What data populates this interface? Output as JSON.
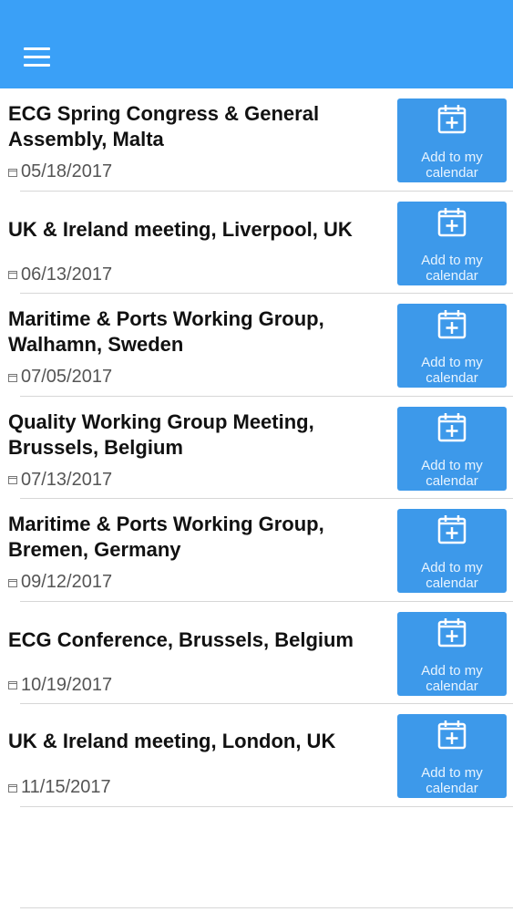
{
  "events": [
    {
      "title": "ECG Spring Congress & General Assembly, Malta",
      "date": "05/18/2017",
      "button_label": "Add to my calendar"
    },
    {
      "title": "UK & Ireland meeting, Liverpool, UK",
      "date": "06/13/2017",
      "button_label": "Add to my calendar"
    },
    {
      "title": "Maritime & Ports Working Group, Walhamn, Sweden",
      "date": "07/05/2017",
      "button_label": "Add to my calendar"
    },
    {
      "title": "Quality Working Group Meeting, Brussels, Belgium",
      "date": "07/13/2017",
      "button_label": "Add to my calendar"
    },
    {
      "title": "Maritime & Ports Working Group, Bremen, Germany",
      "date": "09/12/2017",
      "button_label": "Add to my calendar"
    },
    {
      "title": "ECG Conference, Brussels, Belgium",
      "date": "10/19/2017",
      "button_label": "Add to my calendar"
    },
    {
      "title": "UK & Ireland meeting, London, UK",
      "date": "11/15/2017",
      "button_label": "Add to my calendar"
    }
  ],
  "icons": {
    "menu": "hamburger-menu-icon",
    "date": "calendar-small-icon",
    "add": "calendar-plus-icon"
  },
  "colors": {
    "header": "#3aa0f7",
    "button": "#3d99ea",
    "title_text": "#111111",
    "date_text": "#555555",
    "divider": "#d7d7d7"
  }
}
